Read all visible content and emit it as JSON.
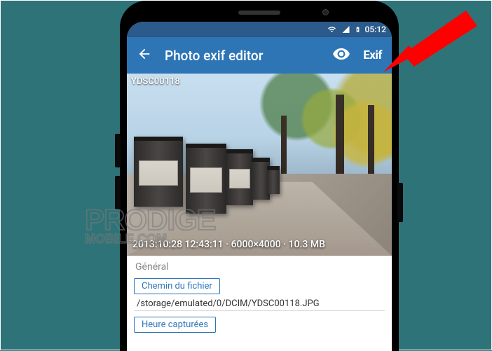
{
  "statusbar": {
    "time": "05:12"
  },
  "appbar": {
    "title": "Photo exif editor",
    "exif_button": "Exif"
  },
  "photo": {
    "filename": "YDSC00118",
    "summary": "2013:10:28 12:43:11 · 6000×4000 · 10.3 MB"
  },
  "details": {
    "section": "Général",
    "field1_label": "Chemin du fichier",
    "field1_value": "/storage/emulated/0/DCIM/YDSC00118.JPG",
    "field2_label": "Heure capturées"
  },
  "watermark": {
    "line1": "PRODIGE",
    "line2": "MOBILE.COM"
  }
}
